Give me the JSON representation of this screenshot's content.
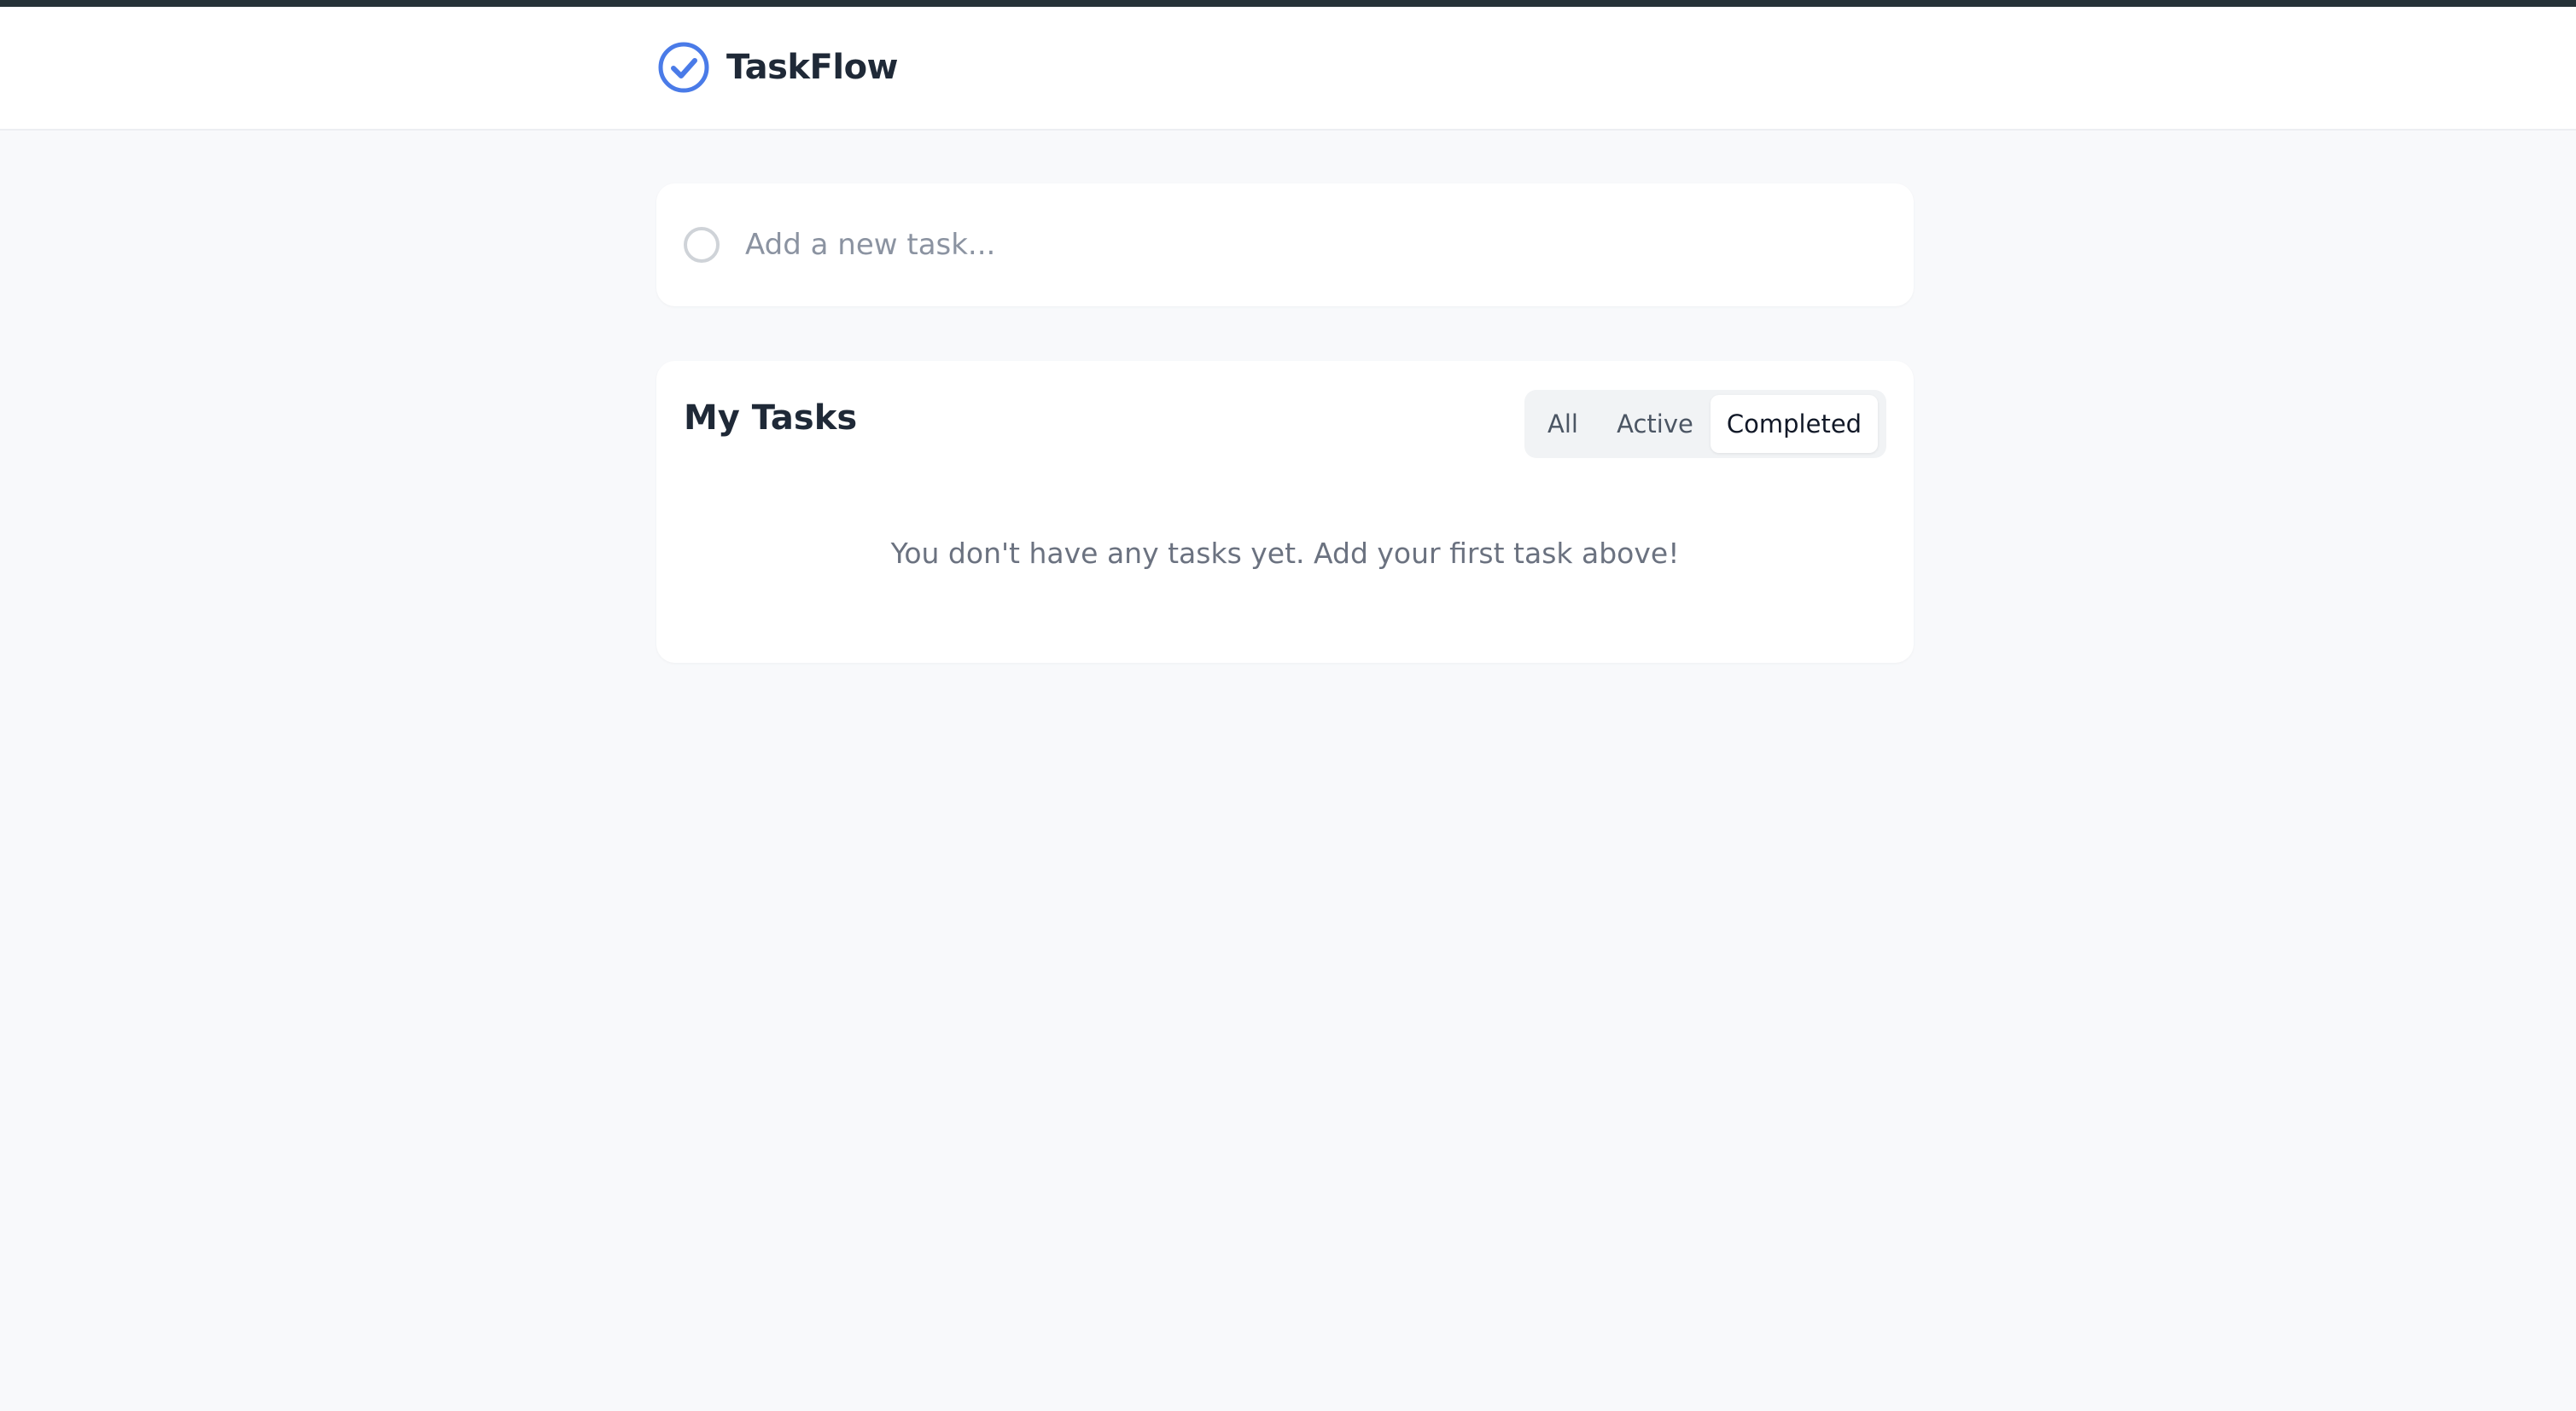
{
  "app": {
    "name": "TaskFlow",
    "logo_icon": "check-circle-icon",
    "accent_color": "#4a7be8"
  },
  "add_task": {
    "placeholder": "Add a new task...",
    "value": ""
  },
  "tasks_panel": {
    "title": "My Tasks",
    "filters": [
      {
        "label": "All",
        "selected": false
      },
      {
        "label": "Active",
        "selected": false
      },
      {
        "label": "Completed",
        "selected": true
      }
    ],
    "empty_message": "You don't have any tasks yet. Add your first task above!"
  }
}
